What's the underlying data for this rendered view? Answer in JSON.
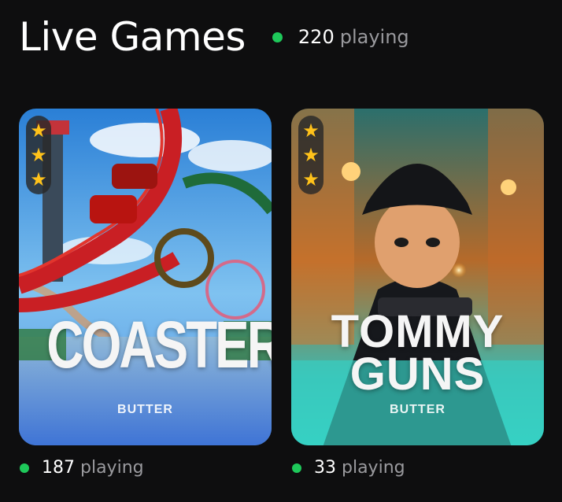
{
  "header": {
    "title": "Live Games",
    "total_count": "220",
    "total_label": "playing"
  },
  "games": [
    {
      "title": "COASTERS",
      "provider": "BUTTER",
      "players_count": "187",
      "players_label": "playing",
      "rating_stars": 3
    },
    {
      "title_line1": "TOMMY",
      "title_line2": "GUNS",
      "provider": "BUTTER",
      "players_count": "33",
      "players_label": "playing",
      "rating_stars": 3
    }
  ],
  "colors": {
    "background": "#0e0e0f",
    "live_dot": "#1ec85a",
    "star": "#ffc21a",
    "muted_text": "#9a9a9e"
  },
  "icons": [
    "live-dot-icon",
    "star-icon"
  ]
}
